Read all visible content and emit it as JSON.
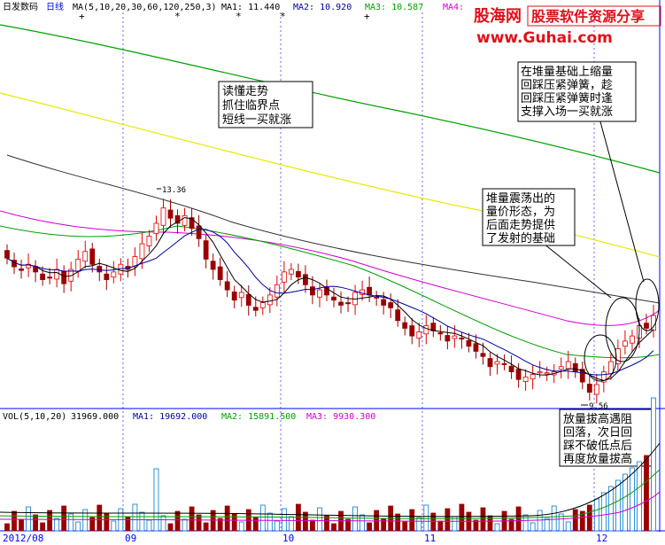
{
  "header": {
    "title": "日发数码",
    "period": "日线",
    "ma_label": "MA(5,10,20,30,60,120,250,3)",
    "ma1": "MA1: 11.440",
    "ma2": "MA2: 10.920",
    "ma3": "MA3: 10.587",
    "ma4": "MA4:"
  },
  "watermark": {
    "brand": "股海网",
    "slogan": "股票软件资源分享",
    "url": "www.Guhai.com"
  },
  "annotations": {
    "a1": [
      "读懂走势",
      "抓住临界点",
      "短线一买就涨"
    ],
    "a2": [
      "在堆量基础上缩量",
      "回踩压紧弹簧，趁",
      "回踩压紧弹簧时逢",
      "支撑入场一买就涨"
    ],
    "a3": [
      "堆量震荡出的",
      "量价形态，为",
      "后面走势提供",
      "了发射的基础"
    ],
    "a4": [
      "放量拔高遇阻",
      "回落，次日回",
      "踩不破低点后",
      "再度放量拔高"
    ]
  },
  "price_labels": {
    "high": "13.36",
    "low": "9.56"
  },
  "vol_header": {
    "label": "VOL(5,10,20)",
    "vol": "31969.000",
    "ma1": "MA1: 19692.000",
    "ma2": "MA2: 15891.500",
    "ma3": "MA3: 9930.300"
  },
  "x_axis": [
    "2012/08",
    "09",
    "10",
    "11",
    "12"
  ],
  "colors": {
    "up": "#e00000",
    "down": "#9a0000",
    "candle_up_fill": "#ffffff",
    "ma5": "#000000",
    "ma10": "#0000a0",
    "ma20": "#00a000",
    "ma30": "#d000d0",
    "ma60": "#303030",
    "ma120": "#e8e800",
    "ma250": "#00a000",
    "grid": "#0000ff"
  },
  "chart_data": {
    "type": "candlestick",
    "period": "daily",
    "price_range": [
      9.56,
      13.36
    ],
    "months": [
      "2012/08",
      "09",
      "10",
      "11",
      "12"
    ],
    "close": [
      12.22,
      12.05,
      11.98,
      12.1,
      11.95,
      11.8,
      11.85,
      12.0,
      11.72,
      12.0,
      12.2,
      12.35,
      12.1,
      11.95,
      11.8,
      11.95,
      12.1,
      12.0,
      12.25,
      12.5,
      12.65,
      12.9,
      13.2,
      13.0,
      12.9,
      13.05,
      12.8,
      12.6,
      12.2,
      12.0,
      11.8,
      11.6,
      11.4,
      11.55,
      11.3,
      11.2,
      11.35,
      11.5,
      11.7,
      11.95,
      12.0,
      11.85,
      11.7,
      11.5,
      11.6,
      11.5,
      11.4,
      11.3,
      11.35,
      11.55,
      11.6,
      11.5,
      11.45,
      11.3,
      11.25,
      11.0,
      10.85,
      10.7,
      10.78,
      10.9,
      10.8,
      10.75,
      10.6,
      10.7,
      10.65,
      10.5,
      10.4,
      10.3,
      10.1,
      10.2,
      10.15,
      10.0,
      9.85,
      9.9,
      9.95,
      10.0,
      9.98,
      10.0,
      10.1,
      10.2,
      10.0,
      9.8,
      9.6,
      9.75,
      10.0,
      10.2,
      10.45,
      10.6,
      10.7,
      10.9,
      10.85,
      11.1
    ]
  }
}
